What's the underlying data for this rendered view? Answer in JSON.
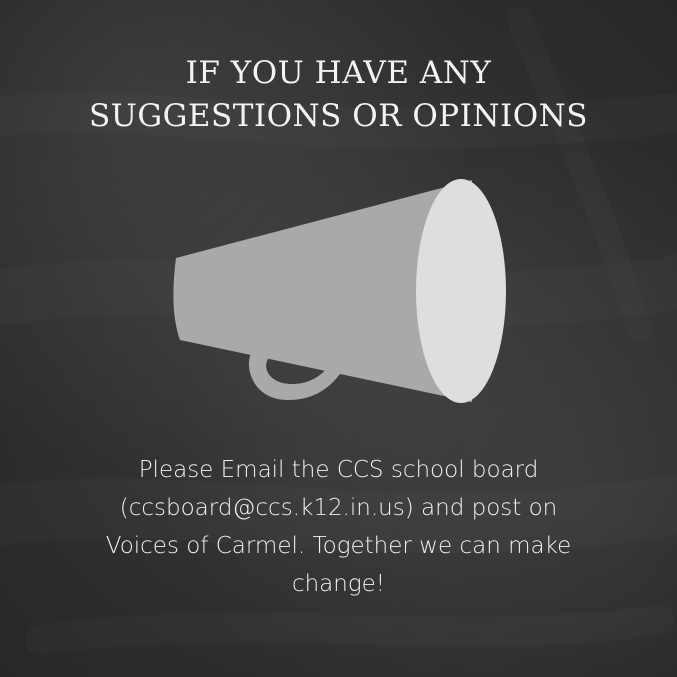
{
  "heading": {
    "line1": "IF YOU HAVE ANY",
    "line2": "SUGGESTIONS OR OPINIONS"
  },
  "message": {
    "line1": "Please Email the CCS school board",
    "line2": "(ccsboard@ccs.k12.in.us) and post on",
    "line3": "Voices of Carmel. Together we can make",
    "line4": "change!"
  },
  "icon": {
    "name": "megaphone-icon"
  },
  "colors": {
    "background": "#333333",
    "text": "#f4f4f4",
    "megaphone_body": "#a9a9a9",
    "megaphone_bell": "#dedede"
  }
}
